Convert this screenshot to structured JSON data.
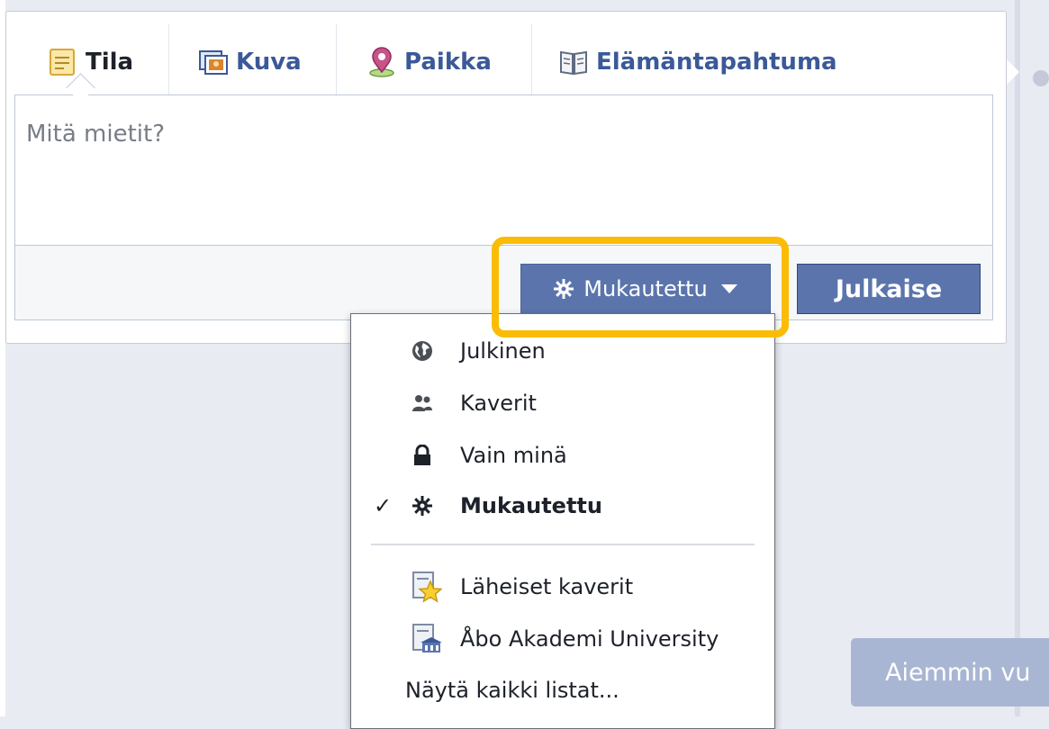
{
  "composer": {
    "tabs": [
      {
        "label": "Tila",
        "icon": "status-note-icon",
        "active": true
      },
      {
        "label": "Kuva",
        "icon": "photo-icon",
        "active": false
      },
      {
        "label": "Paikka",
        "icon": "place-pin-icon",
        "active": false
      },
      {
        "label": "Elämäntapahtuma",
        "icon": "life-event-book-icon",
        "active": false
      }
    ],
    "placeholder": "Mitä mietit?",
    "audience_button": {
      "label": "Mukautettu",
      "icon": "gear-icon"
    },
    "publish_label": "Julkaise"
  },
  "audience_menu": {
    "items": [
      {
        "label": "Julkinen",
        "icon": "globe-icon",
        "selected": false
      },
      {
        "label": "Kaverit",
        "icon": "friends-icon",
        "selected": false
      },
      {
        "label": "Vain minä",
        "icon": "lock-icon",
        "selected": false
      },
      {
        "label": "Mukautettu",
        "icon": "gear-icon",
        "selected": true
      }
    ],
    "lists": [
      {
        "label": "Läheiset kaverit",
        "icon": "close-friends-star-icon"
      },
      {
        "label": "Åbo Akademi University",
        "icon": "school-list-icon"
      }
    ],
    "show_all": "Näytä kaikki listat...",
    "checkmark": "✓"
  },
  "older_button": {
    "label": "Aiemmin vu"
  },
  "colors": {
    "accent": "#5b75ac",
    "link": "#3b5998",
    "highlight": "#fbbc05",
    "background": "#e9ebf3"
  }
}
